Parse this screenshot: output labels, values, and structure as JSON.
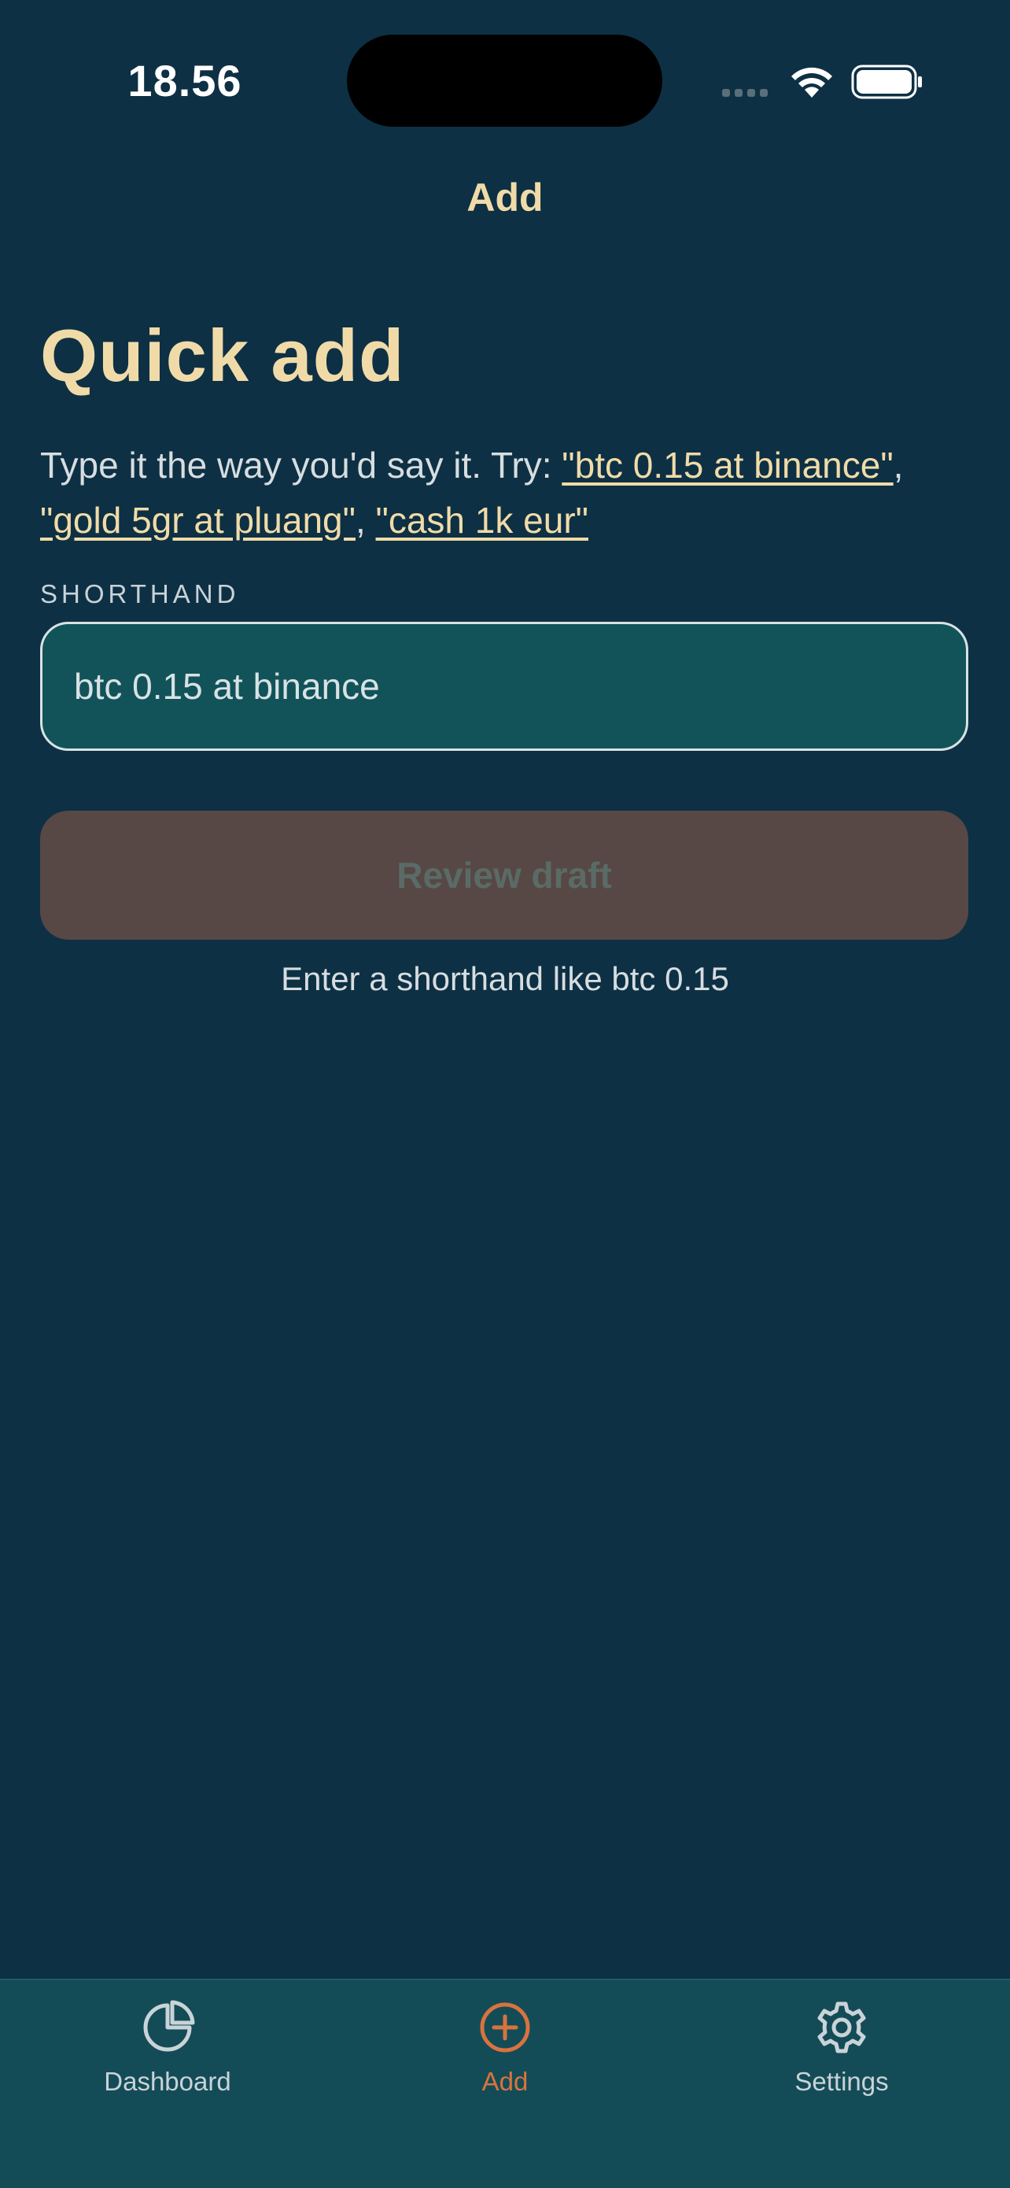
{
  "status_bar": {
    "time": "18.56"
  },
  "nav": {
    "title": "Add"
  },
  "main": {
    "title": "Quick add",
    "hint_prefix": "Type it the way you'd say it. Try: ",
    "examples": [
      "\"btc 0.15 at binance\"",
      "\"gold 5gr at pluang\"",
      "\"cash 1k eur\""
    ],
    "separator": ", ",
    "field_label": "SHORTHAND",
    "input_placeholder": "btc 0.15 at binance",
    "input_value": "",
    "review_button_label": "Review draft",
    "helper_text": "Enter a shorthand like btc 0.15"
  },
  "tabs": [
    {
      "label": "Dashboard",
      "icon": "pie-chart-icon",
      "active": false
    },
    {
      "label": "Add",
      "icon": "plus-circle-icon",
      "active": true
    },
    {
      "label": "Settings",
      "icon": "gear-icon",
      "active": false
    }
  ],
  "colors": {
    "background": "#0d3044",
    "accent": "#f0dba8",
    "active_tab": "#d9733e",
    "input_bg": "#12535a",
    "disabled_button_bg": "#574845"
  }
}
